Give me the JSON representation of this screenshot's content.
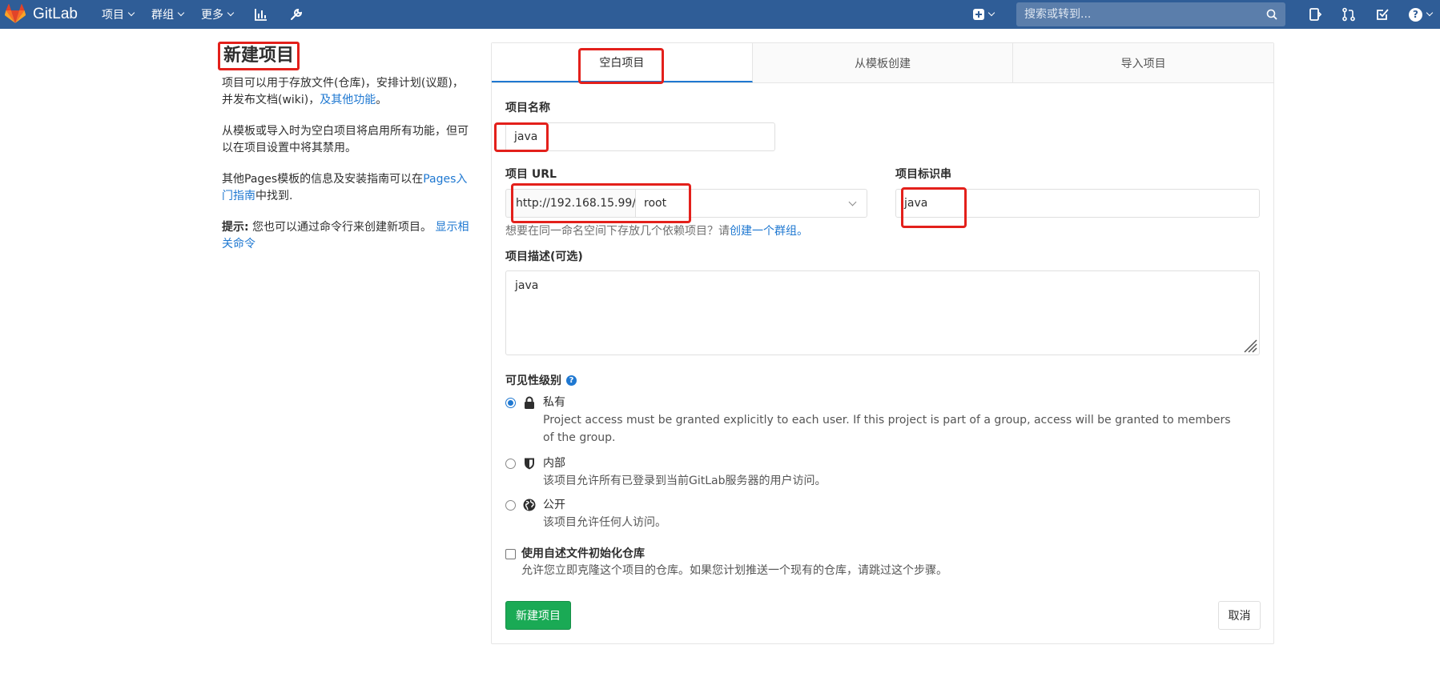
{
  "navbar": {
    "brand": "GitLab",
    "menus": [
      {
        "label": "项目"
      },
      {
        "label": "群组"
      },
      {
        "label": "更多"
      }
    ],
    "search_placeholder": "搜索或转到..."
  },
  "sidebar": {
    "title": "新建项目",
    "para1_text": "项目可以用于存放文件(仓库)，安排计划(议题)，并发布文档(wiki)，",
    "para1_link": "及其他功能",
    "para1_end": "。",
    "para2_text": "从模板或导入时为空白项目将启用所有功能，但可以在项目设置中将其禁用。",
    "para3_text": "其他Pages模板的信息及安装指南可以在",
    "para3_link": "Pages入门指南",
    "para3_end": "中找到.",
    "tip_label": "提示:",
    "tip_text": " 您也可以通过命令行来创建新项目。 ",
    "tip_link": "显示相关命令"
  },
  "tabs": [
    {
      "label": "空白项目",
      "active": true
    },
    {
      "label": "从模板创建",
      "active": false
    },
    {
      "label": "导入项目",
      "active": false
    }
  ],
  "form": {
    "name_label": "项目名称",
    "name_value": "java",
    "url_label": "项目 URL",
    "url_prefix": "http://192.168.15.99/",
    "url_namespace": "root",
    "slug_label": "项目标识串",
    "slug_value": "java",
    "group_help_text": "想要在同一命名空间下存放几个依赖项目？请",
    "group_help_link": "创建一个群组。",
    "desc_label": "项目描述(可选)",
    "desc_value": "java",
    "visibility_label": "可见性级别",
    "visibility": [
      {
        "name": "私有",
        "desc": "Project access must be granted explicitly to each user. If this project is part of a group, access will be granted to members of the group.",
        "icon": "lock-icon",
        "checked": true
      },
      {
        "name": "内部",
        "desc": "该项目允许所有已登录到当前GitLab服务器的用户访问。",
        "icon": "shield-icon",
        "checked": false
      },
      {
        "name": "公开",
        "desc": "该项目允许任何人访问。",
        "icon": "globe-icon",
        "checked": false
      }
    ],
    "readme_label": "使用自述文件初始化仓库",
    "readme_desc": "允许您立即克隆这个项目的仓库。如果您计划推送一个现有的仓库，请跳过这个步骤。",
    "create_button": "新建项目",
    "cancel_button": "取消"
  },
  "colors": {
    "navbar": "#2f5d97",
    "accent": "#1f78d1",
    "success": "#1aaa55",
    "highlight": "#e3201b"
  }
}
